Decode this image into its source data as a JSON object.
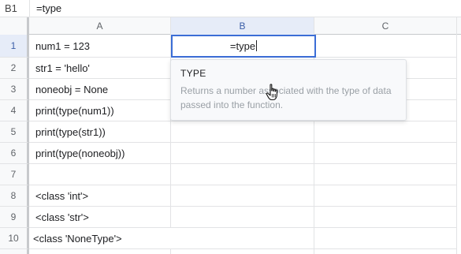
{
  "formula_bar": {
    "name_box": "B1",
    "formula": "=type"
  },
  "columns": [
    "A",
    "B",
    "C"
  ],
  "rows": [
    "1",
    "2",
    "3",
    "4",
    "5",
    "6",
    "7",
    "8",
    "9",
    "10"
  ],
  "cells": {
    "A1": "num1 = 123",
    "A2": "str1 = 'hello'",
    "A3": "noneobj = None",
    "A4": "print(type(num1))",
    "A5": "print(type(str1))",
    "A6": "print(type(noneobj))",
    "A7": "",
    "A8": "<class 'int'>",
    "A9": "<class 'str'>",
    "A10": "<class 'NoneType'>"
  },
  "active_cell": {
    "ref": "B1",
    "value": "=type"
  },
  "tooltip": {
    "title": "TYPE",
    "description": "Returns a number associated with the type of data passed into the function."
  },
  "colors": {
    "accent": "#3b6dd6",
    "header_active_bg": "#e6ecf8",
    "header_bg": "#f8f9fa"
  }
}
